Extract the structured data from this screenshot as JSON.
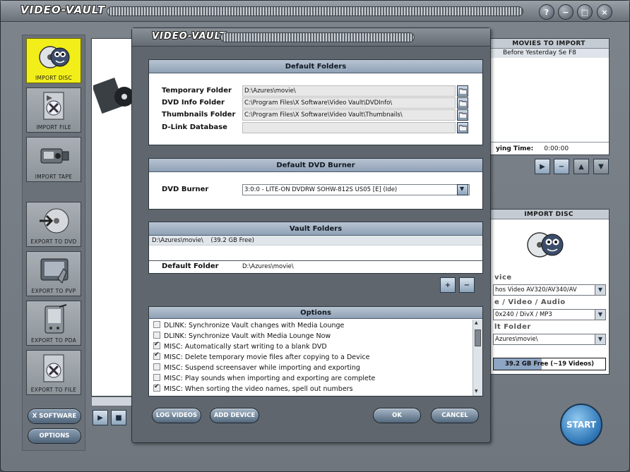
{
  "app": {
    "title": "VIDEO-VAULT"
  },
  "window_controls": {
    "help": "?",
    "minimize": "−",
    "maximize": "□",
    "close": "×"
  },
  "sidebar": {
    "items": [
      {
        "label": "IMPORT DISC"
      },
      {
        "label": "IMPORT FILE"
      },
      {
        "label": "IMPORT TAPE"
      },
      {
        "label": "EXPORT TO DVD"
      },
      {
        "label": "EXPORT TO PVP"
      },
      {
        "label": "EXPORT TO PDA"
      },
      {
        "label": "EXPORT TO FILE"
      }
    ],
    "xsoftware_label": "X SOFTWARE",
    "options_label": "OPTIONS"
  },
  "right": {
    "movies_title": "MOVIES TO IMPORT",
    "movie_item": "Before Yesterday  Se F8",
    "remaining_label": "ying Time:",
    "remaining_value": "0:00:00",
    "import_disc_title": "IMPORT DISC",
    "device_label": "vice",
    "device_value": "hos Video AV320/AV340/AV",
    "format_label": "e / Video / Audio",
    "format_value": "0x240 / DivX / MP3",
    "folder_label": "lt Folder",
    "folder_value": "Azures\\movie\\",
    "free_space": "39.2 GB Free (~19 Videos)",
    "free_fraction": 0.43,
    "start_label": "START"
  },
  "dialog": {
    "title": "VIDEO-VAULT",
    "default_folders": {
      "header": "Default Folders",
      "rows": [
        {
          "label": "Temporary Folder",
          "value": "D:\\Azures\\movie\\"
        },
        {
          "label": "DVD Info Folder",
          "value": "C:\\Program Files\\X Software\\Video Vault\\DVDInfo\\"
        },
        {
          "label": "Thumbnails Folder",
          "value": "C:\\Program Files\\X Software\\Video Vault\\Thumbnails\\"
        },
        {
          "label": "D-Link Database",
          "value": ""
        }
      ]
    },
    "dvd_burner": {
      "header": "Default DVD Burner",
      "label": "DVD Burner",
      "value": "3:0:0 - LITE-ON DVDRW SOHW-812S US05 [E] (Ide)"
    },
    "vault_folders": {
      "header": "Vault Folders",
      "entry": "D:\\Azures\\movie\\    (39.2 GB Free)",
      "default_label": "Default Folder",
      "default_value": "D:\\Azures\\movie\\",
      "add": "+",
      "remove": "−"
    },
    "options": {
      "header": "Options",
      "items": [
        {
          "text": "DLINK: Synchronize Vault changes with Media Lounge",
          "checked": false
        },
        {
          "text": "DLINK: Synchronize Vault with Media Lounge Now",
          "checked": false
        },
        {
          "text": "MISC: Automatically start writing to a blank DVD",
          "checked": true
        },
        {
          "text": "MISC: Delete temporary movie files after copying to a Device",
          "checked": true
        },
        {
          "text": "MISC: Suspend screensaver while importing and exporting",
          "checked": false
        },
        {
          "text": "MISC: Play sounds when importing and exporting are complete",
          "checked": false
        },
        {
          "text": "MISC: When sorting the video names, spell out numbers",
          "checked": true
        }
      ]
    },
    "buttons": {
      "log_videos": "LOG VIDEOS",
      "add_device": "ADD DEVICE",
      "ok": "OK",
      "cancel": "CANCEL"
    }
  }
}
